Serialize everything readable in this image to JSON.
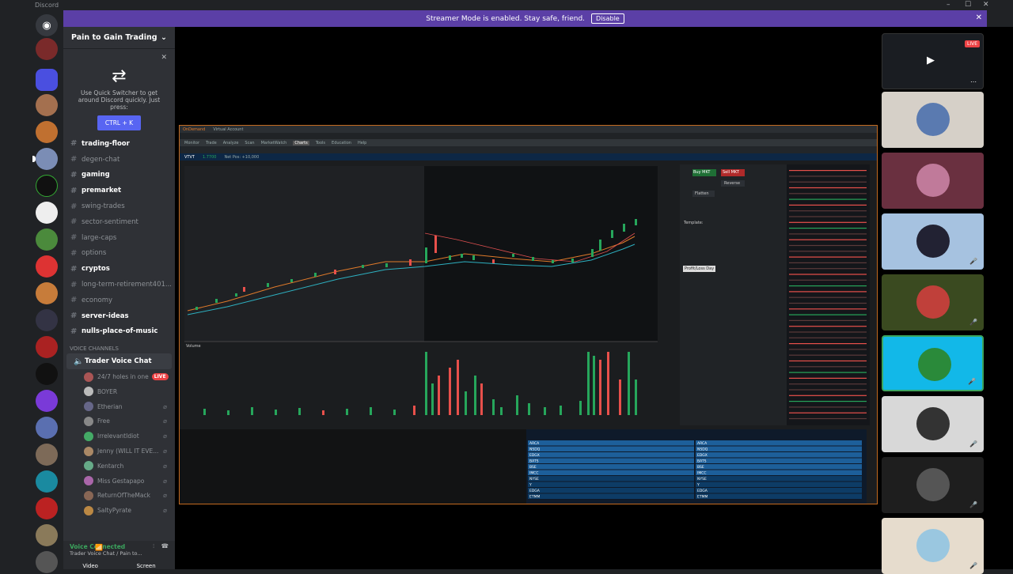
{
  "window": {
    "title": "Discord"
  },
  "banner": {
    "text": "Streamer Mode is enabled. Stay safe, friend.",
    "button": "Disable"
  },
  "guild": {
    "name": "Pain to Gain Trading"
  },
  "quick_switcher": {
    "text": "Use Quick Switcher to get around Discord quickly. Just press:",
    "shortcut": "CTRL + K"
  },
  "channels": [
    {
      "name": "trading-floor",
      "bold": true
    },
    {
      "name": "degen-chat",
      "bold": false
    },
    {
      "name": "gaming",
      "bold": true
    },
    {
      "name": "premarket",
      "bold": true
    },
    {
      "name": "swing-trades",
      "bold": false
    },
    {
      "name": "sector-sentiment",
      "bold": false
    },
    {
      "name": "large-caps",
      "bold": false
    },
    {
      "name": "options",
      "bold": false
    },
    {
      "name": "cryptos",
      "bold": true
    },
    {
      "name": "long-term-retirement401...",
      "bold": false
    },
    {
      "name": "economy",
      "bold": false
    },
    {
      "name": "server-ideas",
      "bold": true
    },
    {
      "name": "nulls-place-of-music",
      "bold": true
    }
  ],
  "voice": {
    "category": "VOICE CHANNELS",
    "channel": "Trader Voice Chat",
    "users": [
      "24/7 holes in one",
      "BOYER",
      "Etherian",
      "Free",
      "IrrelevantIdiot",
      "Jenny (WILL IT EVE...",
      "Kentarch",
      "Miss Gestapapo",
      "ReturnOfTheMack",
      "SaltyPyrate"
    ],
    "live_label": "LIVE"
  },
  "voice_connected": {
    "status": "Voice Connected",
    "detail": "Trader Voice Chat / Pain to...",
    "video": "Video",
    "screen": "Screen"
  },
  "stream": {
    "app": "OnDemand",
    "account": "Virtual Account",
    "symbol": "VTVT",
    "price": "1.7700",
    "net_pos": "Net Pos: +10,000",
    "buy": "Buy MKT",
    "sell": "Sell MKT",
    "flatten": "Flatten",
    "reverse": "Reverse",
    "template": "Template:",
    "tooltip": "Profit/Loss Day",
    "volume": "Volume",
    "menu": [
      "Monitor",
      "Trade",
      "Analyze",
      "Scan",
      "MarketWatch",
      "Charts",
      "Tools",
      "Education",
      "Help"
    ],
    "quote_rows": [
      "ARCA",
      "NSDQ",
      "EDGX",
      "BATS",
      "BSE",
      "IMCC",
      "NYSE",
      "Y",
      "EDGA",
      "ETMM"
    ]
  },
  "right_panel": {
    "live_label": "LIVE"
  },
  "colors": {
    "accent": "#5865f2",
    "banner": "#5b3fa6",
    "up": "#26a65b",
    "down": "#e8504b",
    "orange": "#c46a1f"
  }
}
